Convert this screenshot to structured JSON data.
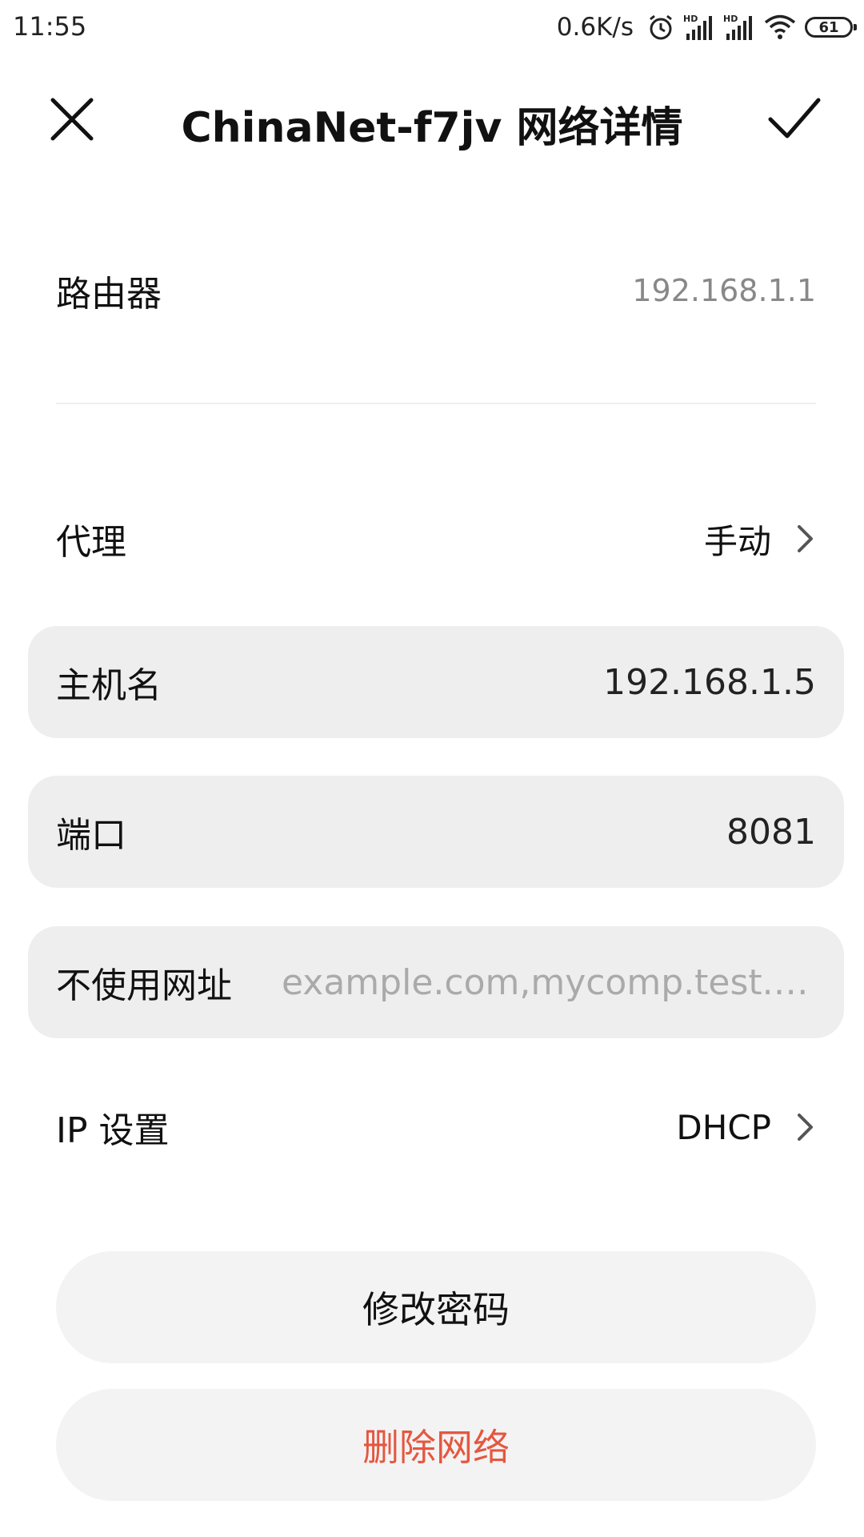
{
  "status_bar": {
    "time": "11:55",
    "speed": "0.6K/s",
    "battery": "61",
    "icons": [
      "alarm-icon",
      "hd-signal-icon",
      "hd-signal-icon",
      "wifi-icon",
      "battery-icon"
    ]
  },
  "title_bar": {
    "title": "ChinaNet-f7jv 网络详情",
    "close_icon": "close-icon",
    "confirm_icon": "check-icon"
  },
  "router": {
    "label": "路由器",
    "value": "192.168.1.1"
  },
  "proxy": {
    "label": "代理",
    "value": "手动"
  },
  "hostname": {
    "label": "主机名",
    "value": "192.168.1.5"
  },
  "port": {
    "label": "端口",
    "value": "8081"
  },
  "bypass": {
    "label": "不使用网址",
    "placeholder": "example.com,mycomp.test.…"
  },
  "ip_settings": {
    "label": "IP 设置",
    "value": "DHCP"
  },
  "buttons": {
    "change_password": "修改密码",
    "delete_network": "删除网络"
  },
  "colors": {
    "accent_delete": "#e5573f",
    "field_bg": "#eeeeee",
    "button_bg": "#f3f3f3"
  }
}
